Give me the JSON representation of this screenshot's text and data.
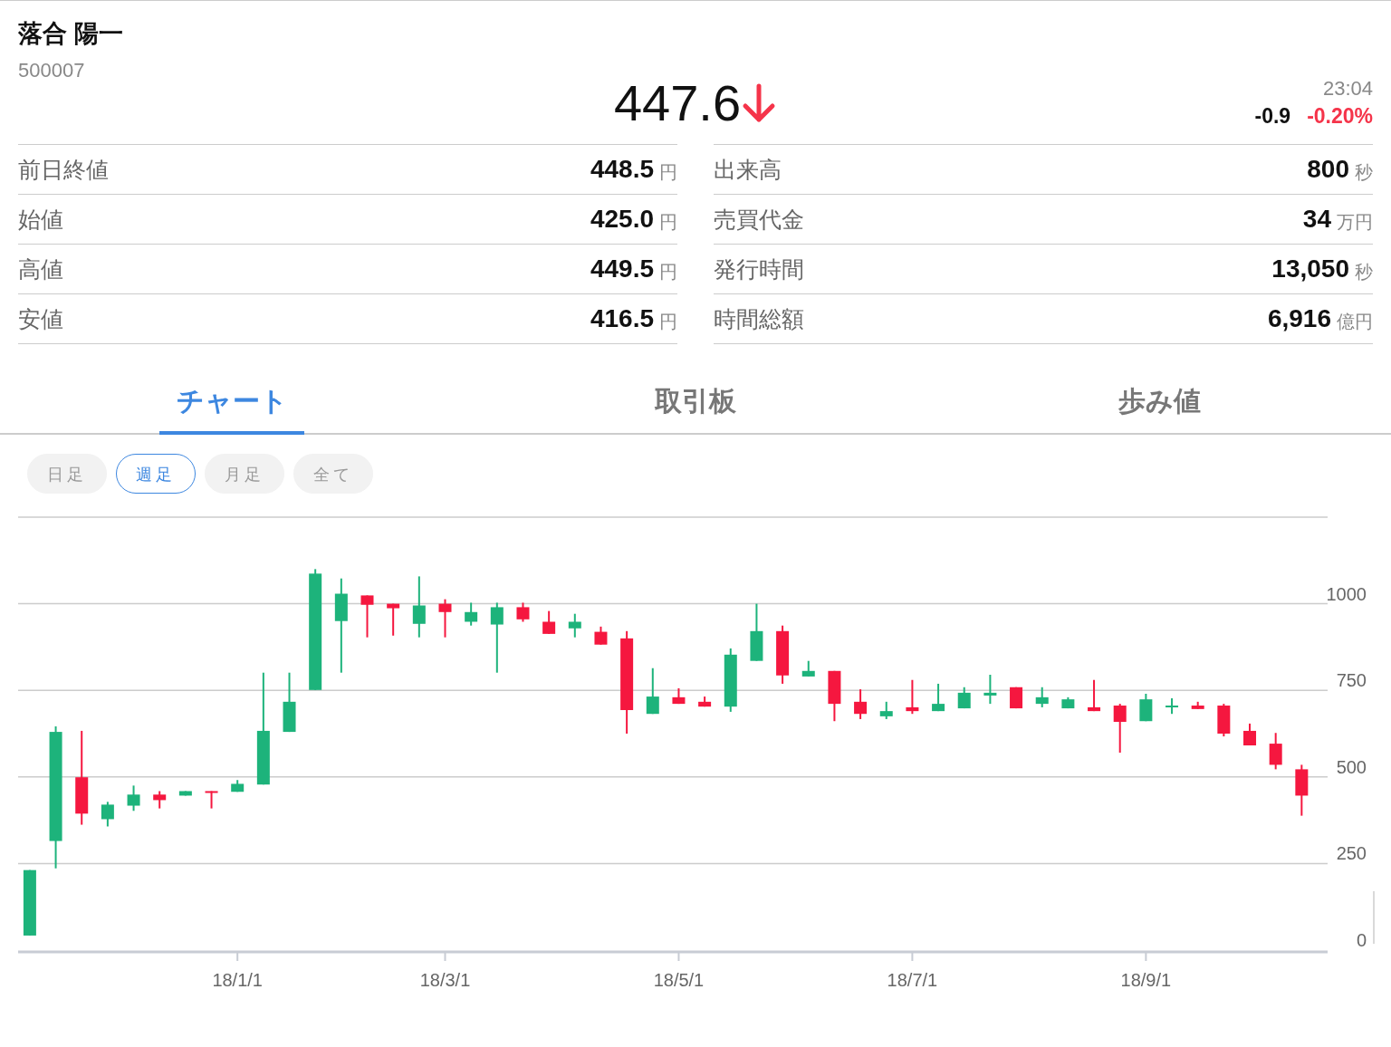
{
  "stock": {
    "name": "落合 陽一",
    "code": "500007"
  },
  "quote": {
    "price": "447.6",
    "time": "23:04",
    "change": "-0.9",
    "change_percent": "-0.20%"
  },
  "stats": [
    [
      {
        "label": "前日終値",
        "value": "448.5",
        "unit": "円"
      },
      {
        "label": "始値",
        "value": "425.0",
        "unit": "円"
      },
      {
        "label": "高値",
        "value": "449.5",
        "unit": "円"
      },
      {
        "label": "安値",
        "value": "416.5",
        "unit": "円"
      }
    ],
    [
      {
        "label": "出来高",
        "value": "800",
        "unit": "秒"
      },
      {
        "label": "売買代金",
        "value": "34",
        "unit": "万円"
      },
      {
        "label": "発行時間",
        "value": "13,050",
        "unit": "秒"
      },
      {
        "label": "時間総額",
        "value": "6,916",
        "unit": "億円"
      }
    ]
  ],
  "tabs": [
    {
      "label": "チャート",
      "selected": true
    },
    {
      "label": "取引板",
      "selected": false
    },
    {
      "label": "歩み値",
      "selected": false
    }
  ],
  "periods": [
    {
      "label": "日足",
      "selected": false
    },
    {
      "label": "週足",
      "selected": true
    },
    {
      "label": "月足",
      "selected": false
    },
    {
      "label": "全て",
      "selected": false
    }
  ],
  "chart": {
    "chart_data": {
      "type": "candlestick",
      "grid": true,
      "categories": [
        null,
        null,
        null,
        null,
        null,
        null,
        null,
        null,
        "18/1/1",
        null,
        null,
        null,
        null,
        null,
        null,
        null,
        "18/3/1",
        null,
        null,
        null,
        null,
        null,
        null,
        null,
        null,
        "18/5/1",
        null,
        null,
        null,
        null,
        null,
        null,
        null,
        null,
        "18/7/1",
        null,
        null,
        null,
        null,
        null,
        null,
        null,
        null,
        "18/9/1",
        null,
        null,
        null,
        null,
        null,
        null
      ],
      "ylim": [
        0,
        1250
      ],
      "yticks": [
        0,
        250,
        500,
        750,
        1000
      ],
      "ohlc": [
        [
          42,
          231,
          42,
          231
        ],
        [
          315,
          646,
          236,
          630
        ],
        [
          499,
          633,
          362,
          394
        ],
        [
          378,
          428,
          357,
          420
        ],
        [
          417,
          475,
          402,
          449
        ],
        [
          449,
          459,
          409,
          433
        ],
        [
          446,
          459,
          446,
          459
        ],
        [
          459,
          459,
          409,
          454
        ],
        [
          457,
          491,
          457,
          480
        ],
        [
          478,
          801,
          478,
          633
        ],
        [
          630,
          801,
          630,
          717
        ],
        [
          751,
          1100,
          751,
          1087
        ],
        [
          950,
          1073,
          801,
          1029
        ],
        [
          1024,
          1024,
          903,
          997
        ],
        [
          1000,
          1000,
          908,
          987
        ],
        [
          942,
          1079,
          903,
          995
        ],
        [
          1000,
          1013,
          903,
          976
        ],
        [
          948,
          1003,
          937,
          976
        ],
        [
          940,
          1003,
          801,
          990
        ],
        [
          990,
          1003,
          948,
          955
        ],
        [
          948,
          979,
          913,
          913
        ],
        [
          929,
          971,
          903,
          948
        ],
        [
          919,
          934,
          882,
          882
        ],
        [
          900,
          921,
          625,
          693
        ],
        [
          682,
          814,
          682,
          732
        ],
        [
          730,
          756,
          711,
          711
        ],
        [
          717,
          732,
          703,
          703
        ],
        [
          703,
          871,
          688,
          853
        ],
        [
          835,
          1000,
          835,
          921
        ],
        [
          921,
          937,
          769,
          793
        ],
        [
          790,
          835,
          790,
          806
        ],
        [
          806,
          806,
          661,
          711
        ],
        [
          717,
          753,
          667,
          682
        ],
        [
          675,
          717,
          667,
          690
        ],
        [
          701,
          780,
          682,
          690
        ],
        [
          690,
          769,
          690,
          711
        ],
        [
          698,
          759,
          698,
          743
        ],
        [
          735,
          795,
          711,
          743
        ],
        [
          759,
          759,
          698,
          698
        ],
        [
          711,
          759,
          701,
          730
        ],
        [
          698,
          730,
          698,
          724
        ],
        [
          701,
          780,
          690,
          690
        ],
        [
          706,
          711,
          570,
          659
        ],
        [
          661,
          740,
          661,
          724
        ],
        [
          701,
          727,
          682,
          706
        ],
        [
          706,
          717,
          696,
          696
        ],
        [
          706,
          711,
          617,
          625
        ],
        [
          633,
          654,
          591,
          591
        ],
        [
          596,
          627,
          522,
          535
        ],
        [
          522,
          535,
          388,
          446
        ]
      ]
    }
  }
}
